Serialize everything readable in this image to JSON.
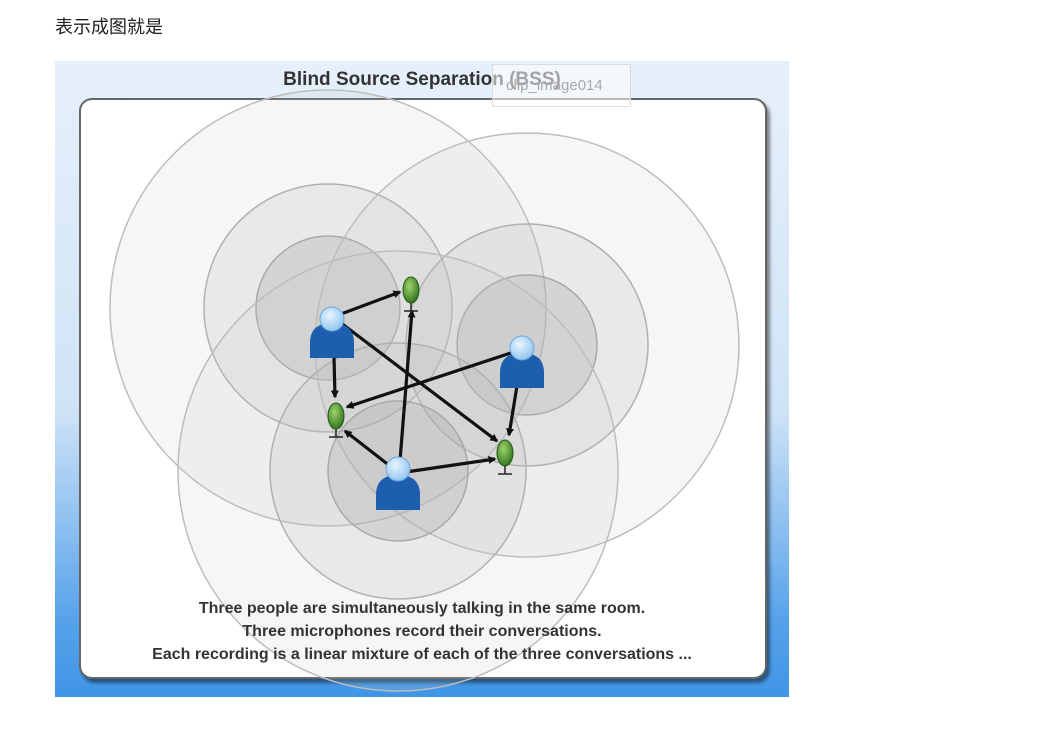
{
  "intro_text": "表示成图就是",
  "figure": {
    "title": "Blind Source Separation (BSS)",
    "caption_lines": [
      "Three people are simultaneously talking in the same room.",
      "Three microphones record their conversations.",
      "Each recording is a linear mixture of each of the three conversations ..."
    ],
    "broken_image_alt": "clip_image014",
    "colors": {
      "person": "#1d5fae",
      "microphone": "#3a8a2a",
      "arrow": "#111111",
      "frame_accent": "#3f95e6"
    },
    "speakers": [
      "person-left",
      "person-right",
      "person-bottom"
    ],
    "microphones": [
      "mic-top",
      "mic-left",
      "mic-right"
    ],
    "arrows": [
      {
        "from": "person-left",
        "to": "mic-top"
      },
      {
        "from": "person-left",
        "to": "mic-left"
      },
      {
        "from": "person-left",
        "to": "mic-right"
      },
      {
        "from": "person-right",
        "to": "mic-left"
      },
      {
        "from": "person-right",
        "to": "mic-right"
      },
      {
        "from": "person-bottom",
        "to": "mic-top"
      },
      {
        "from": "person-bottom",
        "to": "mic-left"
      },
      {
        "from": "person-bottom",
        "to": "mic-right"
      }
    ]
  }
}
